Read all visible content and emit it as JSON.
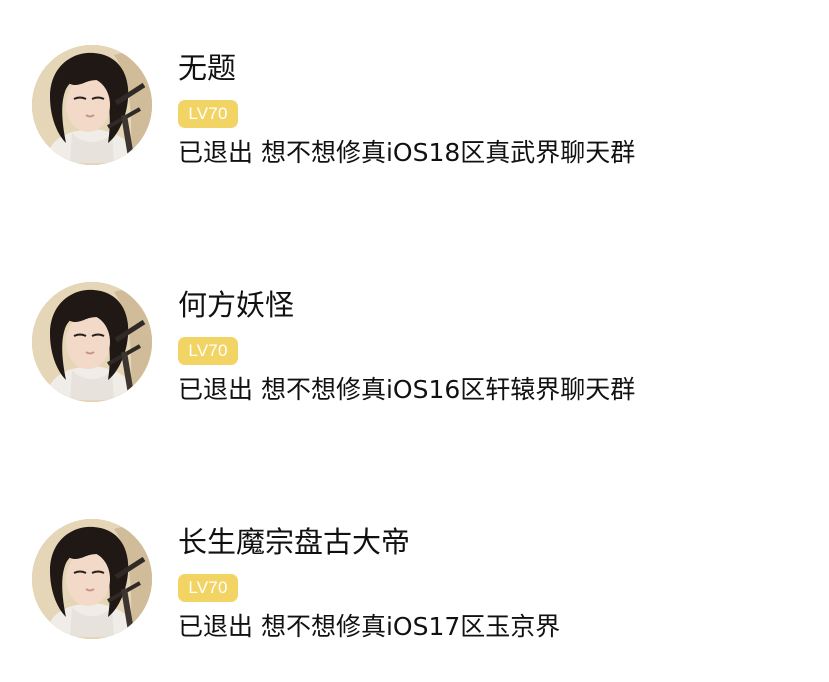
{
  "badge_color": "#f1d463",
  "contacts": [
    {
      "name": "无题",
      "level": "LV70",
      "status": "已退出 想不想修真iOS18区真武界聊天群",
      "avatar_icon": "avatar-portrait-icon"
    },
    {
      "name": "何方妖怪",
      "level": "LV70",
      "status": "已退出 想不想修真iOS16区轩辕界聊天群",
      "avatar_icon": "avatar-portrait-icon"
    },
    {
      "name": "长生魔宗盘古大帝",
      "level": "LV70",
      "status": "已退出 想不想修真iOS17区玉京界",
      "avatar_icon": "avatar-portrait-icon"
    }
  ]
}
